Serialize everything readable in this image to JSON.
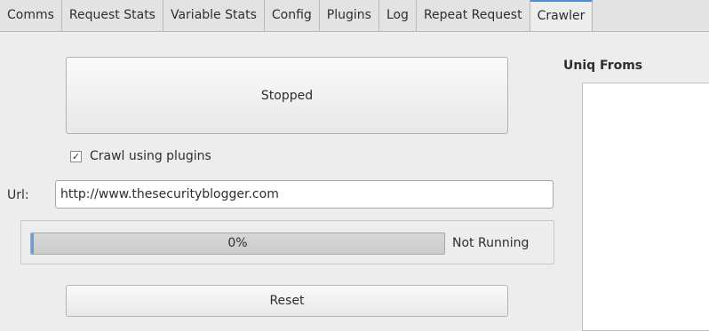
{
  "tabs": [
    {
      "label": "Comms"
    },
    {
      "label": "Request Stats"
    },
    {
      "label": "Variable Stats"
    },
    {
      "label": "Config"
    },
    {
      "label": "Plugins"
    },
    {
      "label": "Log"
    },
    {
      "label": "Repeat Request"
    },
    {
      "label": "Crawler"
    }
  ],
  "active_tab": "Crawler",
  "crawler": {
    "state_button_label": "Stopped",
    "crawl_plugins": {
      "label": "Crawl using plugins",
      "checked": true,
      "check_glyph": "✓"
    },
    "url": {
      "label": "Url:",
      "value": "http://www.thesecurityblogger.com"
    },
    "progress": {
      "text": "0%",
      "fraction": 0.0
    },
    "status_text": "Not Running",
    "reset_label": "Reset"
  },
  "uniq_froms": {
    "title": "Uniq Froms",
    "items": []
  },
  "colors": {
    "accent": "#4a90d9",
    "background": "#ededed"
  }
}
